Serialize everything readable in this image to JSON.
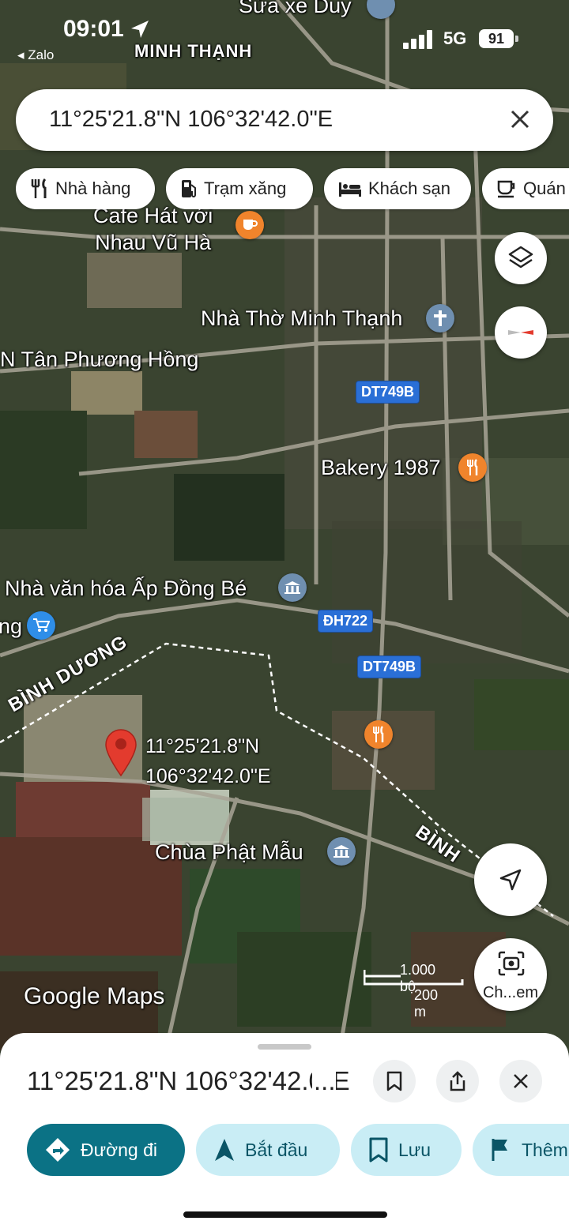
{
  "status_bar": {
    "time": "09:01",
    "back_app": "◂ Zalo",
    "network": "5G",
    "battery": "91"
  },
  "search": {
    "query": "11°25'21.8\"N 106°32'42.0\"E"
  },
  "chips": [
    {
      "label": "Nhà hàng",
      "icon": "fork-knife-icon"
    },
    {
      "label": "Trạm xăng",
      "icon": "gas-pump-icon"
    },
    {
      "label": "Khách sạn",
      "icon": "bed-icon"
    },
    {
      "label": "Quán",
      "icon": "coffee-cup-icon"
    }
  ],
  "map": {
    "labels": {
      "top_place": "Sửa xe Duy",
      "area": "MINH THẠNH",
      "cafe": "Cafe Hát với\nNhau Vũ Hà",
      "church": "Nhà Thờ Minh Thạnh",
      "left_place": "N Tân Phương Hồng",
      "bakery": "Bakery 1987",
      "culture_house": "Nhà văn hóa Ấp Đồng Bé",
      "left_edge": "ng",
      "pagoda": "Chùa Phật Mẫu",
      "region_left": "BÌNH DƯƠNG",
      "region_right": "BÌNH"
    },
    "road_badges": {
      "dt749b_top": "DT749B",
      "dh722": "ĐH722",
      "dt749b_bottom": "DT749B"
    },
    "pin_label_line1": "11°25'21.8\"N",
    "pin_label_line2": "106°32'42.0\"E",
    "logo": "Google Maps",
    "scale_top": "1.000 bộ",
    "scale_bottom": "200 m",
    "camera_label": "Ch...em",
    "colors": {
      "restaurant_poi": "#f0842c",
      "landmark_poi": "#6f8fb0",
      "shop_poi": "#2f8ee8",
      "pin": "#e33b2e"
    }
  },
  "sheet": {
    "title": "11°25'21.8\"N 106°32'42.0\"E",
    "actions": [
      {
        "label": "Đường đi",
        "icon": "directions-icon"
      },
      {
        "label": "Bắt đầu",
        "icon": "navigation-arrow-icon"
      },
      {
        "label": "Lưu",
        "icon": "bookmark-icon"
      },
      {
        "label": "Thêm",
        "icon": "flag-icon"
      }
    ],
    "accent": "#0b7285"
  }
}
